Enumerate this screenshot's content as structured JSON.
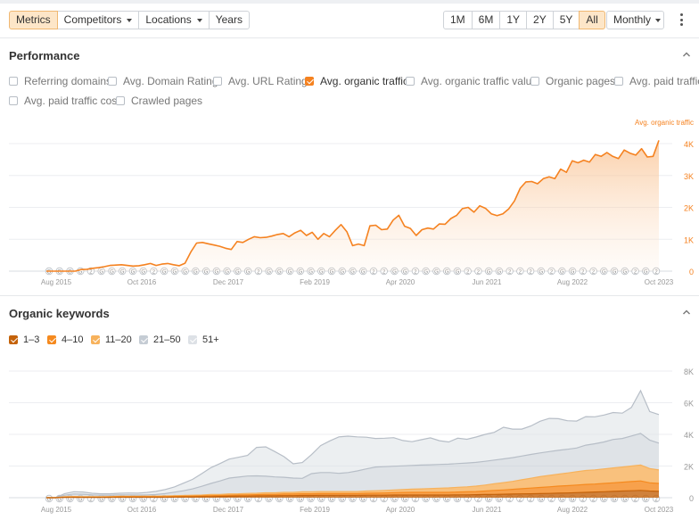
{
  "toolbar": {
    "tabs": [
      {
        "label": "Metrics",
        "active": true
      },
      {
        "label": "Competitors",
        "dropdown": true
      },
      {
        "label": "Locations",
        "dropdown": true
      },
      {
        "label": "Years"
      }
    ],
    "ranges": [
      "1M",
      "6M",
      "1Y",
      "2Y",
      "5Y",
      "All"
    ],
    "active_range": "All",
    "interval": "Monthly"
  },
  "performance": {
    "title": "Performance",
    "metrics": [
      {
        "label": "Referring domains",
        "checked": false
      },
      {
        "label": "Avg. Domain Rating",
        "checked": false
      },
      {
        "label": "Avg. URL Rating",
        "checked": false
      },
      {
        "label": "Avg. organic traffic",
        "checked": true
      },
      {
        "label": "Avg. organic traffic value",
        "checked": false
      },
      {
        "label": "Organic pages",
        "checked": false
      },
      {
        "label": "Avg. paid traffic",
        "checked": false
      },
      {
        "label": "Avg. paid traffic cost",
        "checked": false
      },
      {
        "label": "Crawled pages",
        "checked": false
      }
    ]
  },
  "organic_keywords": {
    "title": "Organic keywords",
    "legend": [
      {
        "label": "1–3",
        "color": "#c4620a"
      },
      {
        "label": "4–10",
        "color": "#f58a1f"
      },
      {
        "label": "11–20",
        "color": "#f7b25c"
      },
      {
        "label": "21–50",
        "color": "#c5ccd4"
      },
      {
        "label": "51+",
        "color": "#dde1e6"
      }
    ]
  },
  "x_tick_labels": [
    "Aug 2015",
    "Oct 2016",
    "Dec 2017",
    "Feb 2019",
    "Apr 2020",
    "Jun 2021",
    "Aug 2022",
    "Oct 2023"
  ],
  "annotation_markers": [
    "G",
    "G",
    "G",
    "G",
    "2",
    "G",
    "G",
    "G",
    "G",
    "G",
    "2",
    "G",
    "G",
    "G",
    "G",
    "G",
    "G",
    "G",
    "G",
    "G",
    "2",
    "G",
    "G",
    "G",
    "G",
    "G",
    "G",
    "G",
    "G",
    "G",
    "G",
    "2",
    "2",
    "G",
    "G",
    "2",
    "G",
    "G",
    "G",
    "G",
    "2",
    "2",
    "G",
    "G",
    "2",
    "2",
    "2",
    "G",
    "2",
    "G",
    "G",
    "2",
    "2",
    "G",
    "G",
    "G",
    "2",
    "G",
    "2"
  ],
  "chart_data": [
    {
      "type": "area",
      "series": [
        {
          "name": "Avg. organic traffic",
          "color": "#f58220",
          "values": [
            0,
            0,
            0,
            0,
            0,
            0,
            50,
            60,
            90,
            110,
            140,
            180,
            190,
            200,
            180,
            160,
            170,
            200,
            240,
            180,
            220,
            240,
            200,
            170,
            250,
            600,
            880,
            900,
            860,
            820,
            780,
            720,
            680,
            930,
            900,
            1000,
            1080,
            1050,
            1060,
            1100,
            1150,
            1180,
            1080,
            1200,
            1280,
            1120,
            1220,
            1000,
            1180,
            1080,
            1280,
            1460,
            1240,
            800,
            850,
            800,
            1420,
            1440,
            1300,
            1320,
            1600,
            1750,
            1410,
            1340,
            1120,
            1300,
            1350,
            1320,
            1480,
            1470,
            1650,
            1750,
            1960,
            2000,
            1850,
            2050,
            1970,
            1800,
            1740,
            1800,
            1950,
            2200,
            2600,
            2800,
            2810,
            2740,
            2900,
            2960,
            2900,
            3200,
            3100,
            3460,
            3400,
            3480,
            3420,
            3660,
            3600,
            3720,
            3600,
            3530,
            3800,
            3700,
            3640,
            3840,
            3580,
            3600,
            4100
          ]
        }
      ],
      "x_ticks": [
        "Aug 2015",
        "Oct 2016",
        "Dec 2017",
        "Feb 2019",
        "Apr 2020",
        "Jun 2021",
        "Aug 2022",
        "Oct 2023"
      ],
      "y_ticks": [
        "0",
        "1K",
        "2K",
        "3K",
        "4K"
      ],
      "ylim": [
        0,
        4000
      ],
      "grid": true,
      "legend_position": "top-right"
    },
    {
      "type": "area",
      "stacked": true,
      "series": [
        {
          "name": "1–3",
          "color": "#c4620a",
          "values": [
            0,
            0,
            20,
            25,
            20,
            20,
            20,
            25,
            30,
            30,
            30,
            30,
            30,
            30,
            40,
            50,
            50,
            60,
            70,
            80,
            90,
            100,
            100,
            110,
            120,
            120,
            130,
            130,
            140,
            140,
            150,
            150,
            150,
            150,
            150,
            160,
            160,
            160,
            170,
            170,
            170,
            170,
            170,
            170,
            170,
            180,
            180,
            190,
            200,
            210,
            220,
            230,
            240,
            250,
            260,
            270,
            290,
            300,
            320,
            340,
            360,
            380,
            400,
            420,
            440,
            460,
            420,
            400
          ]
        },
        {
          "name": "4–10",
          "color": "#f58a1f",
          "values": [
            0,
            0,
            20,
            25,
            20,
            20,
            20,
            25,
            30,
            30,
            30,
            30,
            30,
            40,
            40,
            40,
            50,
            50,
            60,
            60,
            70,
            70,
            80,
            80,
            90,
            90,
            100,
            100,
            110,
            110,
            110,
            110,
            110,
            110,
            110,
            120,
            130,
            140,
            150,
            160,
            170,
            170,
            170,
            170,
            170,
            180,
            190,
            200,
            220,
            250,
            270,
            300,
            330,
            360,
            390,
            420,
            440,
            460,
            480,
            500,
            500,
            520,
            540,
            560,
            580,
            600,
            520,
            500
          ]
        },
        {
          "name": "11–20",
          "color": "#f7b25c",
          "values": [
            0,
            0,
            20,
            25,
            20,
            20,
            20,
            25,
            30,
            30,
            30,
            40,
            40,
            40,
            50,
            50,
            60,
            60,
            70,
            70,
            80,
            80,
            90,
            90,
            100,
            100,
            110,
            110,
            120,
            120,
            130,
            130,
            130,
            130,
            130,
            140,
            150,
            160,
            170,
            180,
            200,
            220,
            240,
            260,
            280,
            300,
            320,
            340,
            380,
            420,
            460,
            500,
            560,
            620,
            680,
            720,
            760,
            800,
            840,
            880,
            900,
            920,
            940,
            960,
            980,
            1000,
            900,
            850
          ]
        },
        {
          "name": "21–50",
          "color": "#c5ccd4",
          "values": [
            0,
            0,
            100,
            160,
            160,
            120,
            100,
            90,
            90,
            90,
            80,
            80,
            100,
            150,
            220,
            300,
            400,
            550,
            700,
            850,
            1000,
            1050,
            1100,
            1100,
            1050,
            1000,
            950,
            900,
            850,
            1150,
            1200,
            1200,
            1150,
            1200,
            1300,
            1400,
            1500,
            1500,
            1500,
            1500,
            1500,
            1500,
            1500,
            1500,
            1500,
            1500,
            1500,
            1500,
            1500,
            1500,
            1500,
            1500,
            1500,
            1500,
            1500,
            1500,
            1500,
            1500,
            1500,
            1600,
            1650,
            1700,
            1800,
            1800,
            1900,
            2000,
            1800,
            1700
          ]
        },
        {
          "name": "51+",
          "color": "#dde1e6",
          "values": [
            0,
            0,
            100,
            140,
            140,
            100,
            90,
            90,
            100,
            120,
            120,
            150,
            200,
            260,
            330,
            480,
            600,
            800,
            1000,
            1100,
            1200,
            1250,
            1300,
            1800,
            1850,
            1600,
            1300,
            900,
            1000,
            1200,
            1700,
            2000,
            2300,
            2300,
            2150,
            2000,
            1800,
            1800,
            1800,
            1600,
            1500,
            1600,
            1700,
            1500,
            1400,
            1600,
            1500,
            1600,
            1700,
            1750,
            2000,
            1800,
            1700,
            1800,
            2000,
            2100,
            2000,
            1800,
            1700,
            1800,
            1700,
            1700,
            1700,
            1600,
            1800,
            2700,
            1800,
            1800
          ]
        }
      ],
      "x_ticks": [
        "Aug 2015",
        "Oct 2016",
        "Dec 2017",
        "Feb 2019",
        "Apr 2020",
        "Jun 2021",
        "Aug 2022",
        "Oct 2023"
      ],
      "y_ticks": [
        "0",
        "2K",
        "4K",
        "6K",
        "8K"
      ],
      "ylim": [
        0,
        8000
      ],
      "grid": true
    }
  ]
}
